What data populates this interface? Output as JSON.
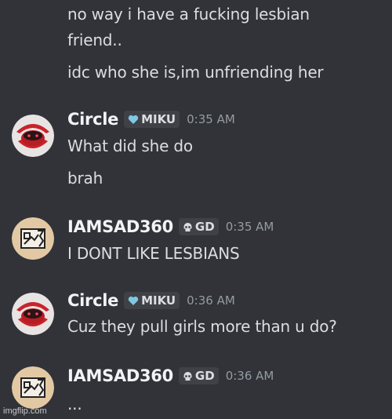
{
  "continuation_messages": [
    "no way i have a fucking lesbian",
    "friend..",
    "idc who she is,im unfriending her"
  ],
  "groups": [
    {
      "username": "Circle",
      "tag_icon": "heart-icon",
      "tag": "MIKU",
      "timestamp": "0:35 AM",
      "messages": [
        "What did she do",
        "brah"
      ]
    },
    {
      "username": "IAMSAD360",
      "tag_icon": "skull-icon",
      "tag": "GD",
      "timestamp": "0:35 AM",
      "messages": [
        "I DONT LIKE LESBIANS"
      ]
    },
    {
      "username": "Circle",
      "tag_icon": "heart-icon",
      "tag": "MIKU",
      "timestamp": "0:36 AM",
      "messages": [
        "Cuz they pull girls more than u do?"
      ]
    },
    {
      "username": "IAMSAD360",
      "tag_icon": "skull-icon",
      "tag": "GD",
      "timestamp": "0:36 AM",
      "messages": [
        "..."
      ]
    }
  ],
  "watermark": "imgflip.com",
  "colors": {
    "background": "#313338",
    "text": "#dbdee1",
    "username": "#f2f3f5",
    "timestamp": "#949ba4",
    "heart": "#7ec8e3"
  }
}
